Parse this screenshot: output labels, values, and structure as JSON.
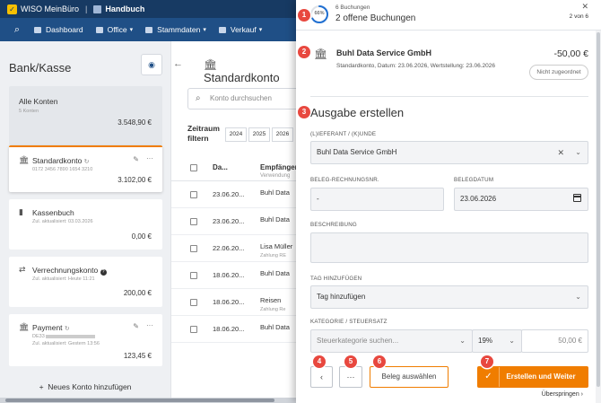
{
  "app": {
    "brand": "WISO MeinBüro",
    "module": "Handbuch"
  },
  "nav": {
    "items": [
      "Dashboard",
      "Office",
      "Stammdaten",
      "Verkauf"
    ]
  },
  "left": {
    "title": "Bank/Kasse",
    "accounts": [
      {
        "name": "Alle Konten",
        "sub": "5 Konten",
        "amount": "3.548,90 €"
      },
      {
        "name": "Standardkonto",
        "sub": "0172 3456 7890 1654 3210",
        "amount": "3.102,00 €"
      },
      {
        "name": "Kassenbuch",
        "sub": "Zul. aktualisiert: 03.03.2026",
        "amount": "0,00 €"
      },
      {
        "name": "Verrechnungskonto",
        "sub": "Zul. aktualisiert: Heute 11:21",
        "amount": "200,00 €"
      },
      {
        "name": "Payment",
        "sub1": "DE33",
        "sub2": "Zul. aktualisiert: Gestern 13:56",
        "amount": "123,45 €"
      }
    ],
    "add_account": "Neues Konto hinzufügen"
  },
  "middle": {
    "title": "Standardkonto",
    "search_placeholder": "Konto durchsuchen",
    "filter_label": "Zeitraum filtern",
    "years": [
      "2024",
      "2025",
      "2026"
    ],
    "col_date": "Da...",
    "col_name": "Empfänger",
    "col_name_sub": "Verwendung",
    "rows": [
      {
        "date": "23.06.20...",
        "name": "Buhl Data",
        "sub": ""
      },
      {
        "date": "23.06.20...",
        "name": "Buhl Data",
        "sub": ""
      },
      {
        "date": "22.06.20...",
        "name": "Lisa Müller",
        "sub": "Zahlung RE"
      },
      {
        "date": "18.06.20...",
        "name": "Buhl Data",
        "sub": ""
      },
      {
        "date": "18.06.20...",
        "name": "Reisen",
        "sub": "Zahlung Re"
      },
      {
        "date": "18.06.20...",
        "name": "Buhl Data",
        "sub": ""
      }
    ]
  },
  "panel": {
    "progress_percent": 66,
    "progress_label": "66%",
    "bookings_count": "6 Buchungen",
    "open_bookings": "2 offene Buchungen",
    "position": "2 von 6",
    "booking": {
      "name": "Buhl Data Service GmbH",
      "amount": "-50,00 €",
      "details": "Standardkonto, Datum: 23.06.2026, Wertstellung: 23.06.2026",
      "status_button": "Nicht zugeordnet"
    },
    "section_title": "Ausgabe erstellen",
    "fields": {
      "supplier_label": "(L)IEFERANT / (K)UNDE",
      "supplier_value": "Buhl Data Service GmbH",
      "invoice_no_label": "BELEG-RECHNUNGSNR.",
      "invoice_no_value": "-",
      "invoice_date_label": "BELEGDATUM",
      "invoice_date_value": "23.06.2026",
      "description_label": "BESCHREIBUNG",
      "description_value": "",
      "tag_label": "TAG HINZUFÜGEN",
      "tag_placeholder": "Tag hinzufügen",
      "category_label": "KATEGORIE / STEUERSATZ",
      "category_placeholder": "Steuerkategorie suchen...",
      "tax_rate": "19%",
      "amount_placeholder": "50,00 €"
    },
    "footer": {
      "more_label": "···",
      "select_receipt": "Beleg auswählen",
      "create_next": "Erstellen und Weiter",
      "skip": "Überspringen ›"
    }
  },
  "markers": [
    "1",
    "2",
    "3",
    "4",
    "5",
    "6",
    "7"
  ],
  "colors": {
    "accent": "#f07d00",
    "nav_dark": "#173a63",
    "nav": "#1f4f86",
    "marker": "#e8483f",
    "progress": "#1f6fd1"
  }
}
